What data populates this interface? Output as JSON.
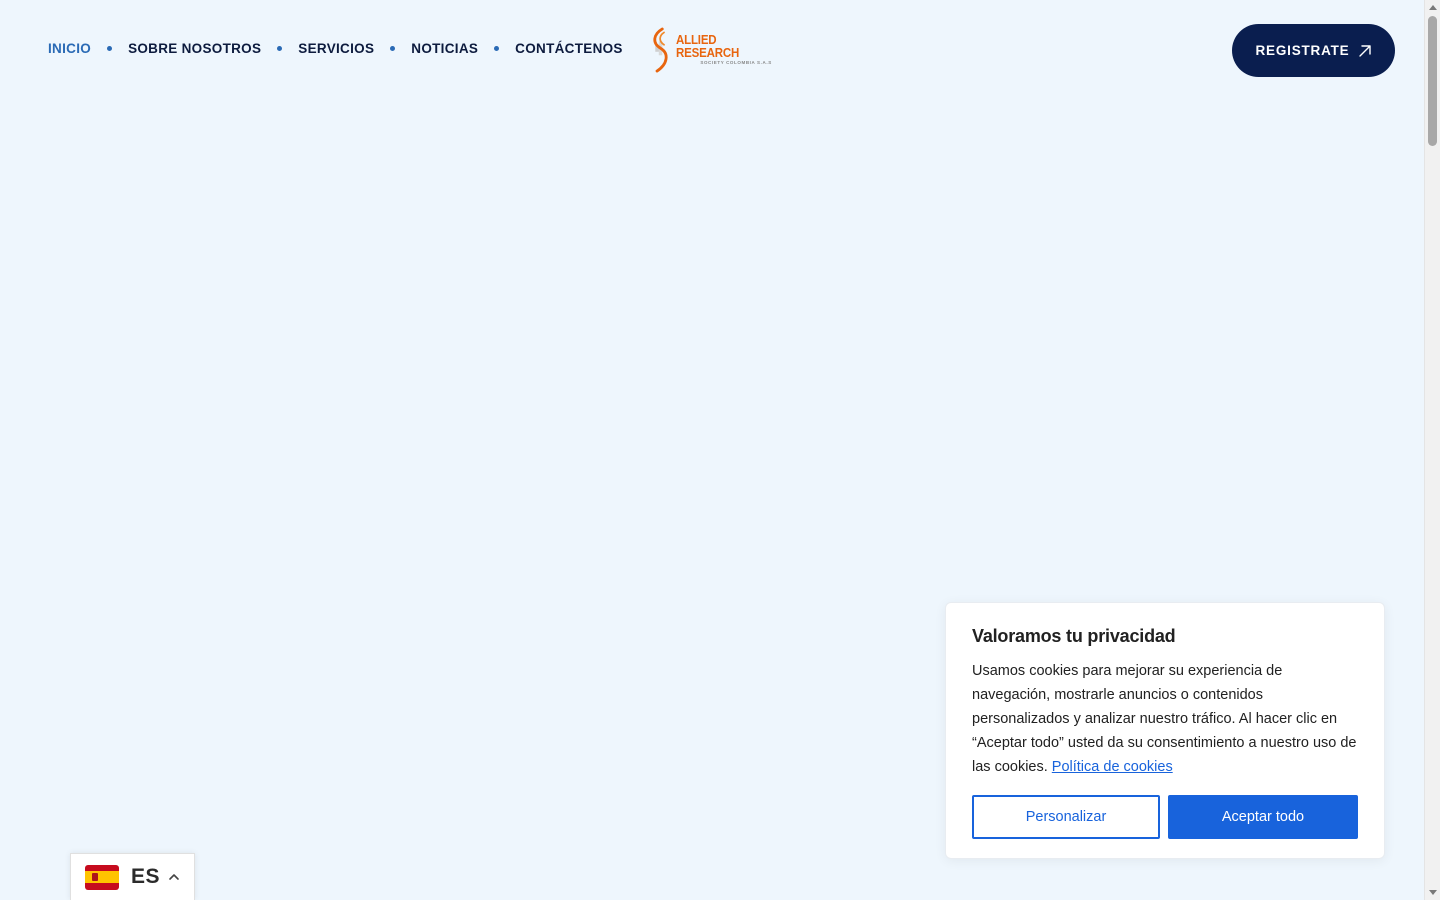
{
  "nav": {
    "items": [
      {
        "label": "INICIO",
        "active": true
      },
      {
        "label": "SOBRE NOSOTROS",
        "active": false
      },
      {
        "label": "SERVICIOS",
        "active": false
      },
      {
        "label": "NOTICIAS",
        "active": false
      },
      {
        "label": "CONTÁCTENOS",
        "active": false
      }
    ]
  },
  "logo": {
    "main": "ALLIED RESEARCH",
    "sub": "SOCIETY COLOMBIA S.A.S"
  },
  "header": {
    "register_label": "REGISTRATE"
  },
  "cookie": {
    "title": "Valoramos tu privacidad",
    "body": "Usamos cookies para mejorar su experiencia de navegación, mostrarle anuncios o contenidos personalizados y analizar nuestro tráfico. Al hacer clic en “Aceptar todo” usted da su consentimiento a nuestro uso de las cookies.",
    "policy_link": "Política de cookies",
    "customize_label": "Personalizar",
    "accept_label": "Aceptar todo"
  },
  "language": {
    "code": "ES"
  },
  "colors": {
    "background": "#eef6fd",
    "navy": "#0a1e4f",
    "accent_blue": "#2a6ab5",
    "cookie_blue": "#1863dc",
    "logo_orange": "#e8650f"
  }
}
